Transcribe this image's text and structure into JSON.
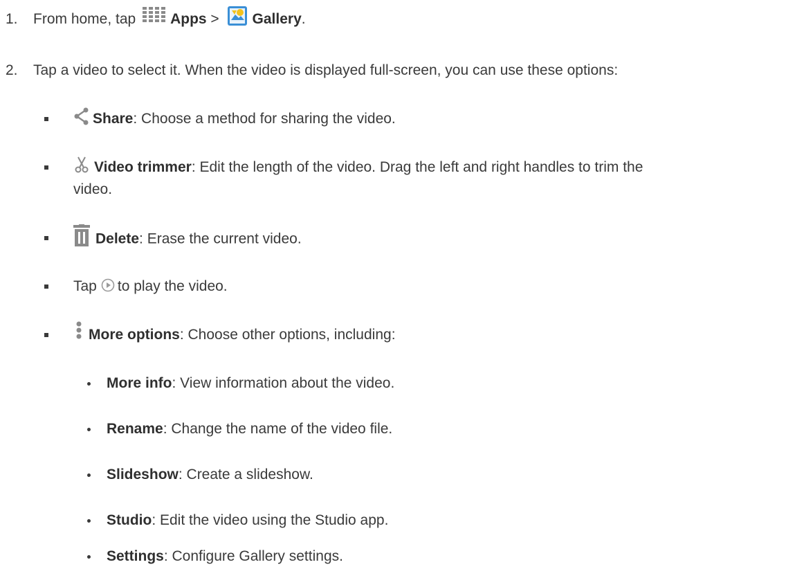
{
  "step1": {
    "number": "1.",
    "text_before": "From home, tap",
    "apps_label": "Apps",
    "separator": ">",
    "gallery_label": "Gallery",
    "end": "."
  },
  "step2": {
    "number": "2.",
    "text": "Tap a video to select it. When the video is displayed full-screen, you can use these options:"
  },
  "options": {
    "share": {
      "label": "Share",
      "desc": ": Choose a method for sharing the video."
    },
    "trimmer": {
      "label": "Video trimmer",
      "desc": ": Edit the length of the video. Drag the left and right handles to trim the",
      "desc_cont": "video."
    },
    "delete": {
      "label": "Delete",
      "desc": ": Erase the current video."
    },
    "play": {
      "before": "Tap",
      "after": "to play the video."
    },
    "more": {
      "label": "More options",
      "desc": ": Choose other options, including:"
    }
  },
  "more_options": [
    {
      "label": "More info",
      "desc": ": View information about the video."
    },
    {
      "label": "Rename",
      "desc": ": Change the name of the video file."
    },
    {
      "label": "Slideshow",
      "desc": ": Create a slideshow."
    },
    {
      "label": "Studio",
      "desc": ": Edit the video using the Studio app."
    },
    {
      "label": "Settings",
      "desc": ": Configure Gallery settings."
    }
  ],
  "colors": {
    "text": "#3a3a3a",
    "icon_gray": "#8a8a8a",
    "gallery_blue": "#3a8fd6",
    "gallery_yellow": "#f4c21b"
  }
}
